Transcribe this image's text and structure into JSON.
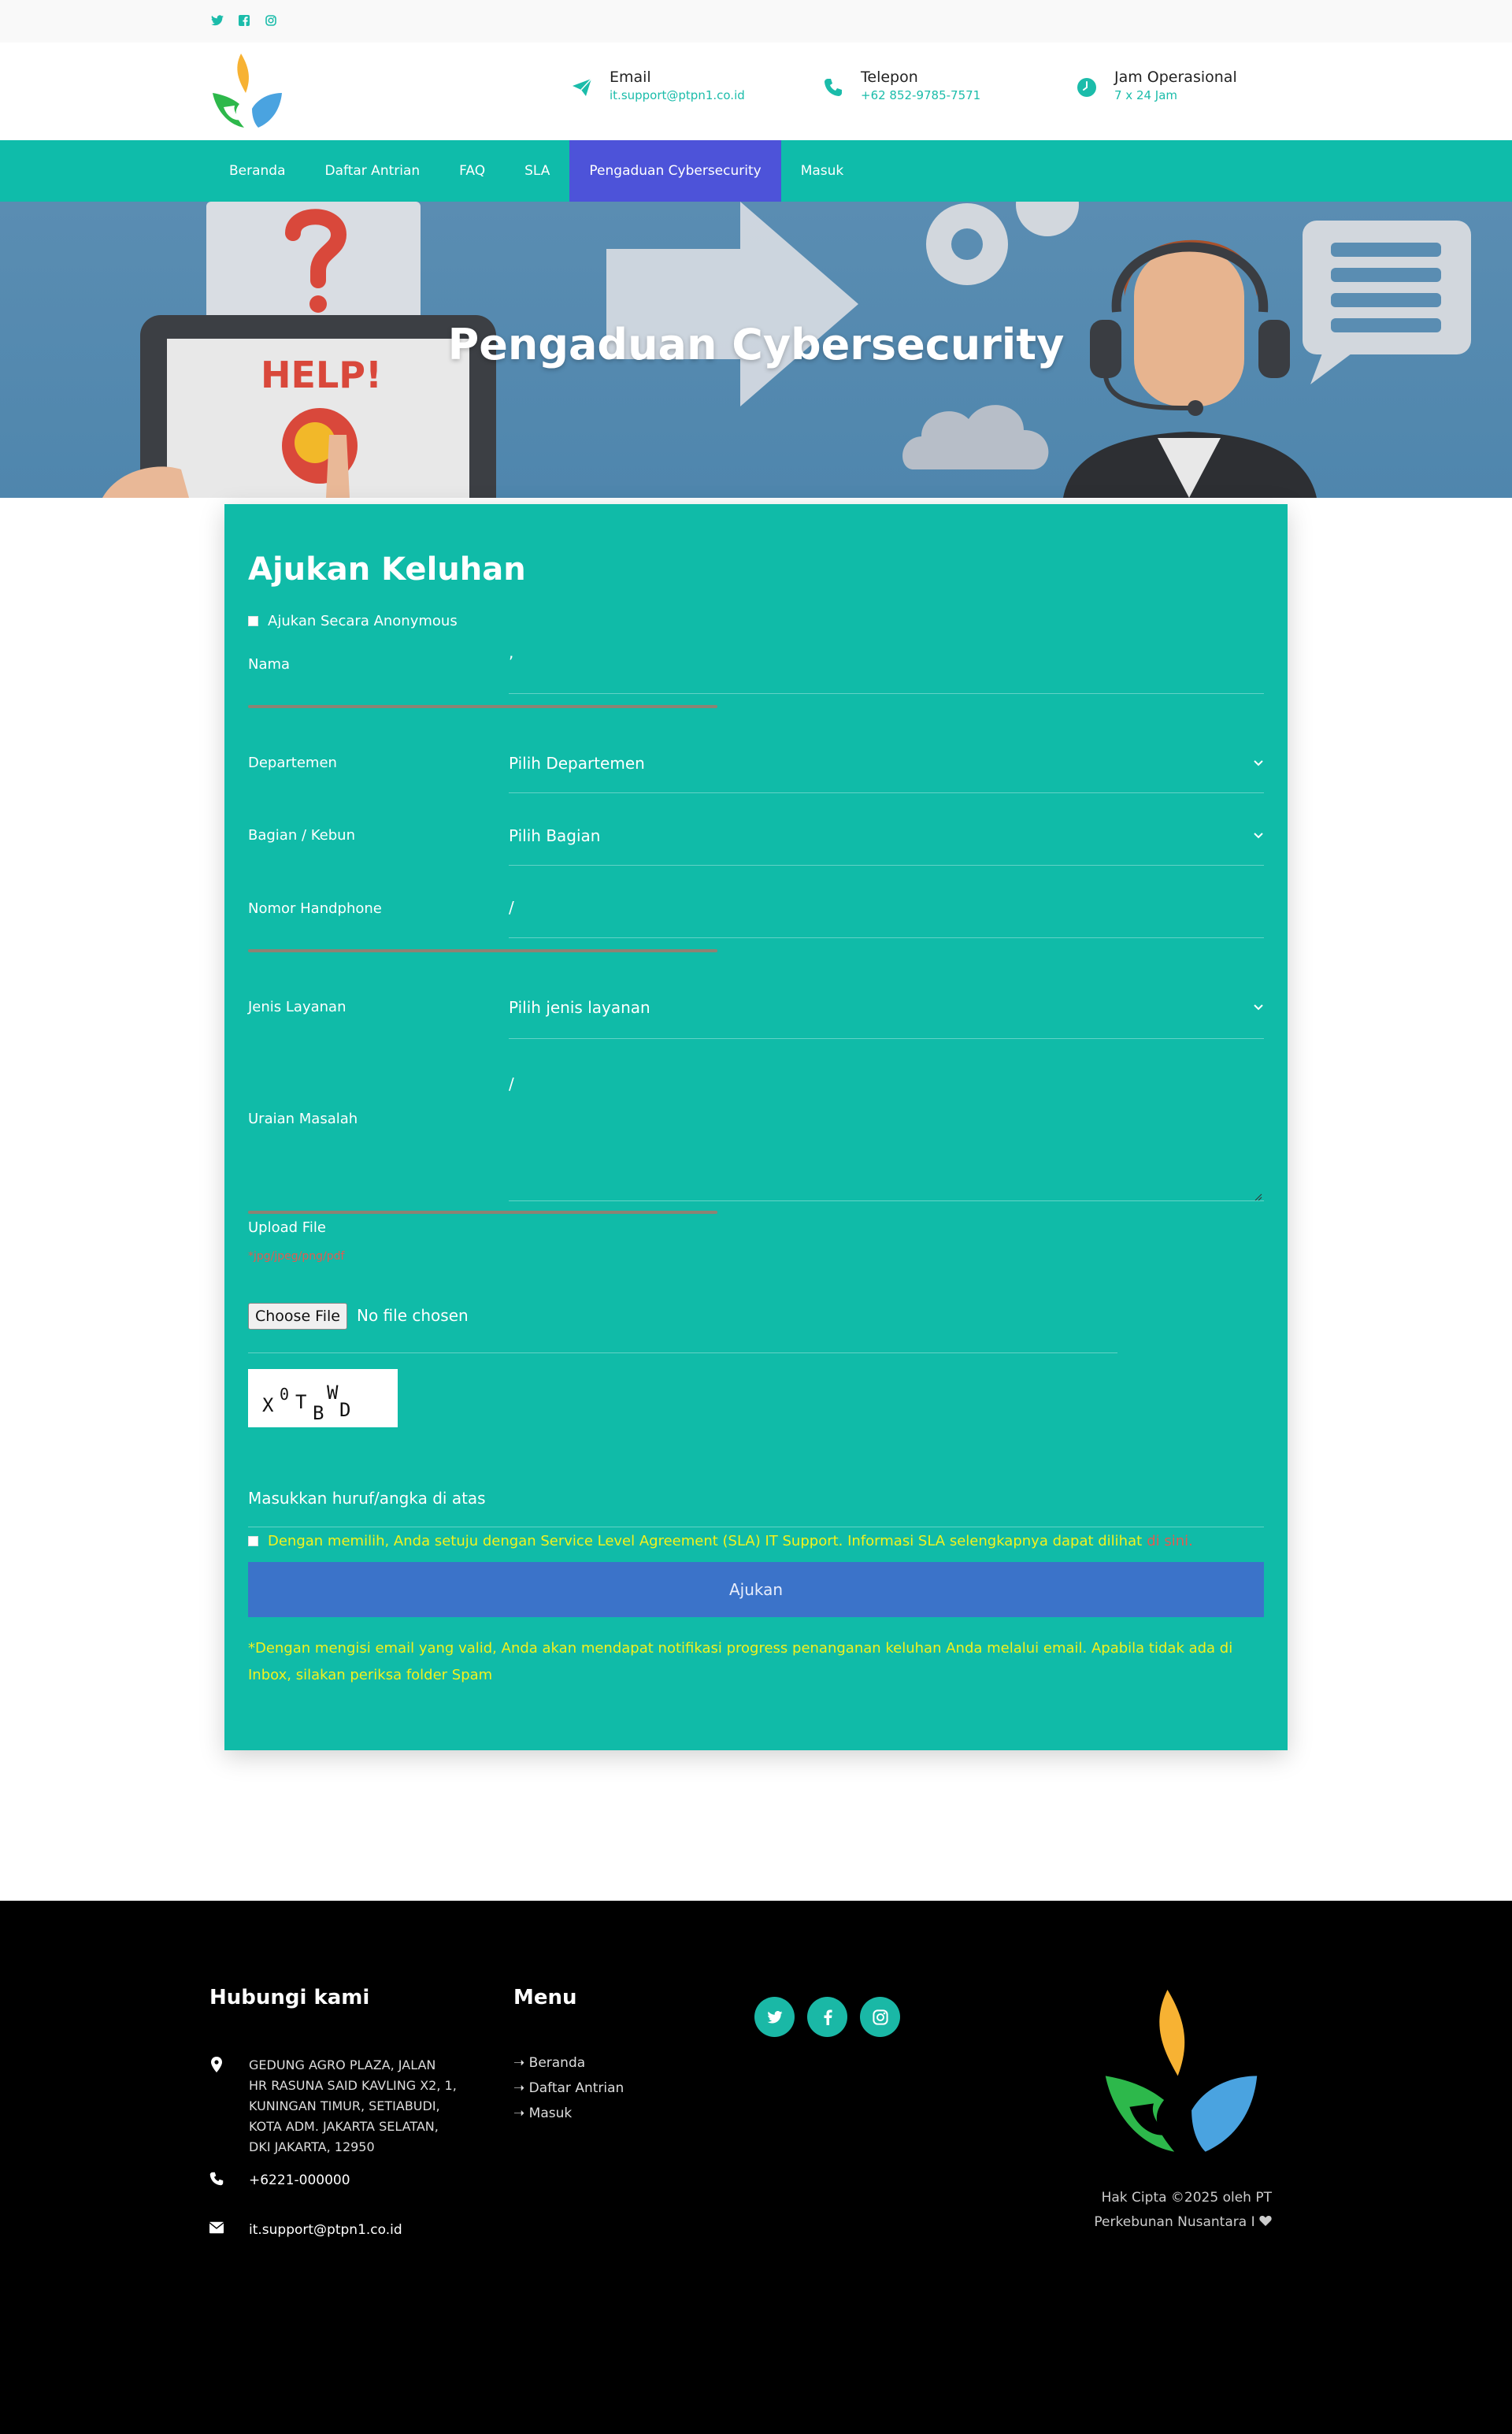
{
  "topbar": {
    "social_icons": [
      "twitter-icon",
      "facebook-icon",
      "instagram-icon"
    ]
  },
  "header": {
    "contacts": [
      {
        "label": "Email",
        "value": "it.support@ptpn1.co.id",
        "icon": "paper-plane-icon"
      },
      {
        "label": "Telepon",
        "value": "+62 852-9785-7571",
        "icon": "phone-icon"
      },
      {
        "label": "Jam Operasional",
        "value": "7 x 24 Jam",
        "icon": "clock-icon"
      }
    ]
  },
  "nav": {
    "items": [
      "Beranda",
      "Daftar Antrian",
      "FAQ",
      "SLA",
      "Pengaduan Cybersecurity",
      "Masuk"
    ],
    "active": "Pengaduan Cybersecurity"
  },
  "hero": {
    "title": "Pengaduan Cybersecurity",
    "illustration_text": "HELP!"
  },
  "form": {
    "heading": "Ajukan Keluhan",
    "anonymous_label": "Ajukan Secara Anonymous",
    "nama": {
      "label": "Nama",
      "value": ","
    },
    "departemen": {
      "label": "Departemen",
      "value": "Pilih Departemen"
    },
    "bagian": {
      "label": "Bagian / Kebun",
      "value": "Pilih Bagian"
    },
    "handphone": {
      "label": "Nomor Handphone",
      "value": "/"
    },
    "jenis_layanan": {
      "label": "Jenis Layanan",
      "value": "Pilih jenis layanan"
    },
    "uraian": {
      "label": "Uraian Masalah",
      "value": "/"
    },
    "upload": {
      "label": "Upload File",
      "types": "*jpg/jpeg/png/pdf",
      "button": "Choose File",
      "status": "No file chosen"
    },
    "captcha_chars": [
      "X",
      "0",
      "T",
      "B",
      "W",
      "D"
    ],
    "captcha_input_label": "Masukkan huruf/angka di atas",
    "agree_text": "Dengan memilih, Anda setuju dengan Service Level Agreement (SLA) IT Support. Informasi SLA selengkapnya dapat dilihat",
    "agree_link": "di sini.",
    "submit": "Ajukan",
    "note": "*Dengan mengisi email yang valid, Anda akan mendapat notifikasi progress penanganan keluhan Anda melalui email. Apabila tidak ada di Inbox, silakan periksa folder Spam"
  },
  "footer": {
    "contact_heading": "Hubungi kami",
    "address_lines": [
      "GEDUNG AGRO PLAZA, JALAN",
      "HR RASUNA SAID KAVLING X2, 1,",
      "KUNINGAN TIMUR, SETIABUDI,",
      "KOTA ADM. JAKARTA SELATAN,",
      "DKI JAKARTA, 12950"
    ],
    "phone": "+6221-000000",
    "email": "it.support@ptpn1.co.id",
    "menu_heading": "Menu",
    "menu_items": [
      "Beranda",
      "Daftar Antrian",
      "Masuk"
    ],
    "social_icons": [
      "twitter-icon",
      "facebook-icon",
      "instagram-icon"
    ],
    "copyright_line1": "Hak Cipta ©2025 oleh PT",
    "copyright_line2": "Perkebunan Nusantara I"
  },
  "colors": {
    "primary_teal": "#0fbcaa",
    "nav_active": "#4d53d9",
    "submit_blue": "#3b73c9",
    "hint_red": "#e25b50",
    "note_yellow": "#f4f21c",
    "footer_bg": "#000000"
  }
}
